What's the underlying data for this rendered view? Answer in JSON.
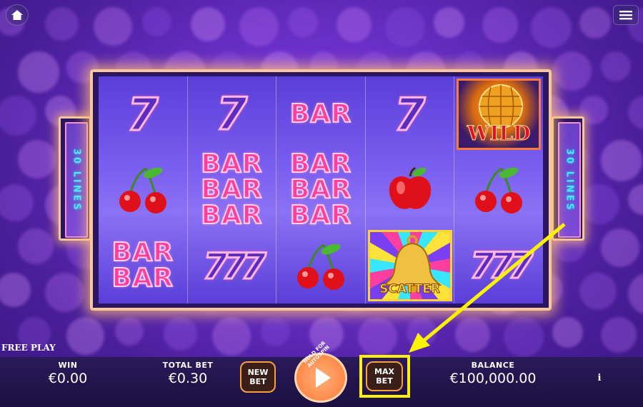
{
  "side_panels": {
    "left_label": "30 LINES",
    "right_label": "30 LINES"
  },
  "reels": [
    [
      "7",
      "cherry",
      "BAR BAR"
    ],
    [
      "7",
      "BAR BAR BAR",
      "777"
    ],
    [
      "BAR",
      "BAR BAR BAR",
      "cherry"
    ],
    [
      "7",
      "apple",
      "scatter-bell"
    ],
    [
      "wild-disco",
      "cherry",
      "777"
    ]
  ],
  "symbols": {
    "seven": "7",
    "triple_seven": "777",
    "bar": "BAR",
    "wild": "WILD",
    "scatter": "SCATTER"
  },
  "bottom": {
    "free_play": "FREE PLAY",
    "win_label": "WIN",
    "win_value": "€0.00",
    "total_bet_label": "TOTAL BET",
    "total_bet_value": "€0.30",
    "new_bet_label": "NEW BET",
    "spin_hint": "HOLD FOR AUTOSPIN",
    "max_bet_label": "MAX BET",
    "balance_label": "BALANCE",
    "balance_value": "€100,000.00",
    "info_label": "i"
  },
  "colors": {
    "highlight": "#fff200",
    "accent": "#f8a040"
  }
}
